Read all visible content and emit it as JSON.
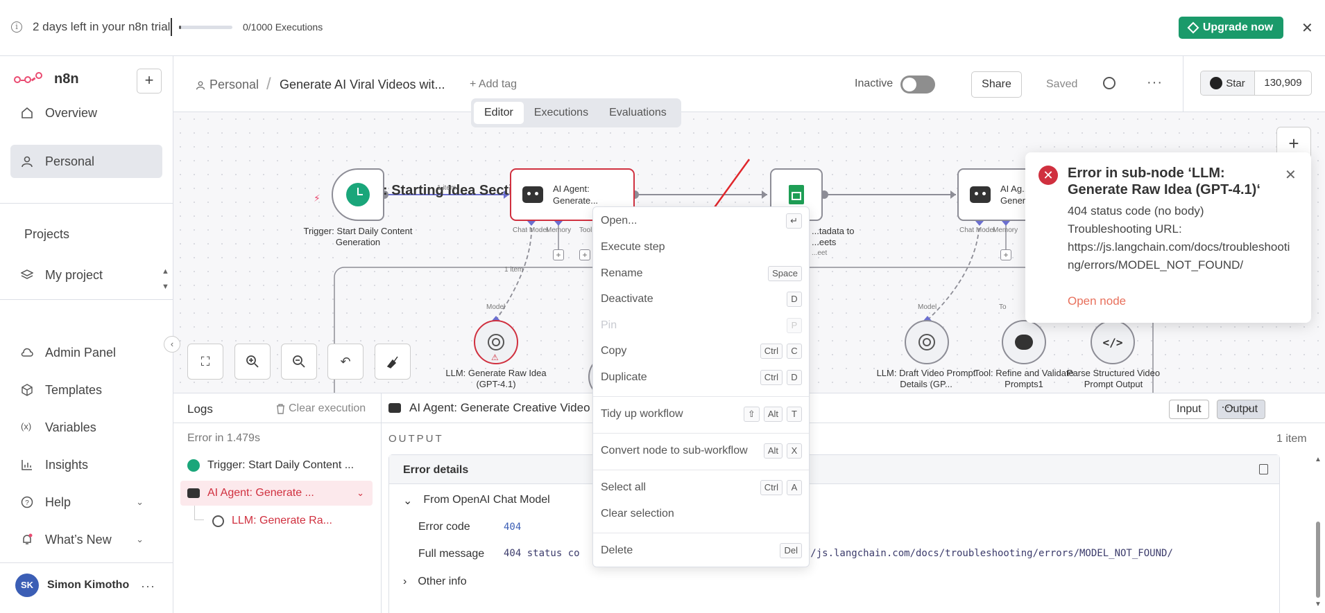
{
  "banner": {
    "trial_text": "2 days left in your n8n trial",
    "executions_text": "0/1000 Executions",
    "progress": 0.03,
    "upgrade_label": "Upgrade now"
  },
  "sidebar": {
    "logo_text": "n8n",
    "items": [
      {
        "label": "Overview"
      },
      {
        "label": "Personal"
      }
    ],
    "projects_label": "Projects",
    "project_items": [
      {
        "label": "My project"
      }
    ],
    "bottom_items": [
      {
        "label": "Admin Panel"
      },
      {
        "label": "Templates"
      },
      {
        "label": "Variables"
      },
      {
        "label": "Insights"
      },
      {
        "label": "Help"
      },
      {
        "label": "What’s New"
      }
    ],
    "user": {
      "initials": "SK",
      "name": "Simon Kimotho"
    }
  },
  "header": {
    "breadcrumb_personal": "Personal",
    "workflow_name": "Generate AI Viral Videos wit...",
    "add_tag": "+ Add tag",
    "inactive_label": "Inactive",
    "share_label": "Share",
    "saved_label": "Saved",
    "star_label": "Star",
    "star_count": "130,909"
  },
  "tabs": [
    {
      "label": "Editor"
    },
    {
      "label": "Executions"
    },
    {
      "label": "Evaluations"
    }
  ],
  "canvas": {
    "section_title": ": Starting Idea Secti",
    "edge_label_1": "1 item",
    "edge_label_2": "1 item",
    "nodes": {
      "trigger_label": "Trigger: Start Daily Content Generation",
      "agent1_label": "AI Agent: Generate...",
      "sheets_label": "...tadata to ...eets",
      "sheets_sub": "...eet",
      "agent2_label": "AI Ag... Gener...",
      "llm1_label": "LLM: Generate Raw Idea (GPT-4.1)",
      "llm2_label": "LLM: Draft Video Prompt Details (GP...",
      "tool_label": "Tool: Refine and Validate Prompts1",
      "parser_label": "Parse Structured Video Prompt Output"
    },
    "port_labels": {
      "chat_model": "Chat Model",
      "memory": "Memory",
      "tool": "Tool",
      "model": "Model",
      "to": "To"
    }
  },
  "logs": {
    "title": "Logs",
    "clear_label": "Clear execution",
    "error_time": "Error in 1.479s",
    "rows": [
      {
        "label": "Trigger: Start Daily Content ..."
      },
      {
        "label": "AI Agent: Generate ..."
      },
      {
        "label": "LLM: Generate Ra..."
      }
    ]
  },
  "detail": {
    "title": "AI Agent: Generate Creative Video Id",
    "input_label": "Input",
    "output_label": "Output",
    "output_heading": "OUTPUT",
    "item_count": "1 item",
    "error_details": "Error details",
    "from_label": "From OpenAI Chat Model",
    "error_code_key": "Error code",
    "error_code_val": "404",
    "full_message_key": "Full message",
    "full_message_val_start": "404 status co",
    "full_message_val_end": "s://js.langchain.com/docs/troubleshooting/errors/MODEL_NOT_FOUND/",
    "other_info": "Other info"
  },
  "context_menu": {
    "items": [
      {
        "label": "Open...",
        "keys": [
          "↵"
        ]
      },
      {
        "label": "Execute step",
        "keys": []
      },
      {
        "label": "Rename",
        "keys": [
          "Space"
        ]
      },
      {
        "label": "Deactivate",
        "keys": [
          "D"
        ]
      },
      {
        "label": "Pin",
        "keys": [
          "P"
        ]
      },
      {
        "label": "Copy",
        "keys": [
          "Ctrl",
          "C"
        ]
      },
      {
        "label": "Duplicate",
        "keys": [
          "Ctrl",
          "D"
        ]
      },
      {
        "label": "Tidy up workflow",
        "keys": [
          "⇧",
          "Alt",
          "T"
        ]
      },
      {
        "label": "Convert node to sub-workflow",
        "keys": [
          "Alt",
          "X"
        ]
      },
      {
        "label": "Select all",
        "keys": [
          "Ctrl",
          "A"
        ]
      },
      {
        "label": "Clear selection",
        "keys": []
      },
      {
        "label": "Delete",
        "keys": [
          "Del"
        ]
      }
    ]
  },
  "toast": {
    "title": "Error in sub-node ‘LLM: Generate Raw Idea (GPT-4.1)‘",
    "line1": "404 status code (no body)",
    "line2": "Troubleshooting URL:",
    "url": "https://js.langchain.com/docs/troubleshooting/errors/MODEL_NOT_FOUND/",
    "link": "Open node"
  },
  "colors": {
    "accent": "#ea4b71",
    "upgrade": "#1a9a6a",
    "error": "#d0303f",
    "link": "#e8705c"
  }
}
